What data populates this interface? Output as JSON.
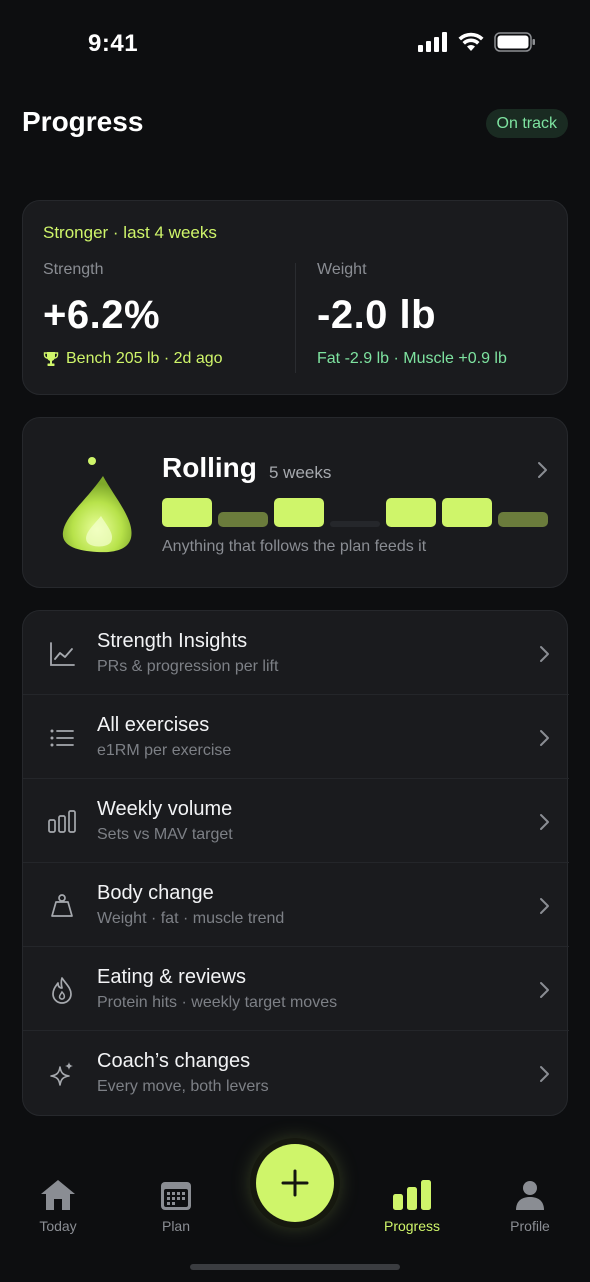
{
  "status_bar": {
    "time": "9:41"
  },
  "header": {
    "title": "Progress",
    "badge": "On track"
  },
  "summary": {
    "heading": "Stronger · last 4 weeks",
    "strength": {
      "label": "Strength",
      "value": "+6.2%",
      "sub": "Bench 205 lb · 2d ago"
    },
    "weight": {
      "label": "Weight",
      "value": "-2.0 lb",
      "sub": "Fat -2.9 lb · Muscle +0.9 lb"
    }
  },
  "rolling": {
    "title": "Rolling",
    "weeks": "5 weeks",
    "caption": "Anything that follows the plan feeds it",
    "streak_levels": [
      1,
      0.5,
      1,
      0,
      1,
      1,
      0.5
    ]
  },
  "list": [
    {
      "title": "Strength Insights",
      "subtitle": "PRs & progression per lift",
      "icon": "chart-line-icon"
    },
    {
      "title": "All exercises",
      "subtitle": "e1RM per exercise",
      "icon": "list-icon"
    },
    {
      "title": "Weekly volume",
      "subtitle": "Sets vs MAV target",
      "icon": "bar-chart-icon"
    },
    {
      "title": "Body change",
      "subtitle": "Weight · fat · muscle trend",
      "icon": "scale-weight-icon"
    },
    {
      "title": "Eating & reviews",
      "subtitle": "Protein hits · weekly target moves",
      "icon": "flame-icon"
    },
    {
      "title": "Coach’s changes",
      "subtitle": "Every move, both levers",
      "icon": "sparkle-icon"
    }
  ],
  "tabs": [
    {
      "label": "Today",
      "icon": "home-icon"
    },
    {
      "label": "Plan",
      "icon": "calendar-icon"
    },
    {
      "label": "Progress",
      "icon": "bar-chart-icon",
      "active": true
    },
    {
      "label": "Profile",
      "icon": "person-icon"
    }
  ],
  "colors": {
    "accent": "#cff56a",
    "positive": "#7ee3a0",
    "background": "#0d0e10",
    "card": "#1a1b1e"
  }
}
